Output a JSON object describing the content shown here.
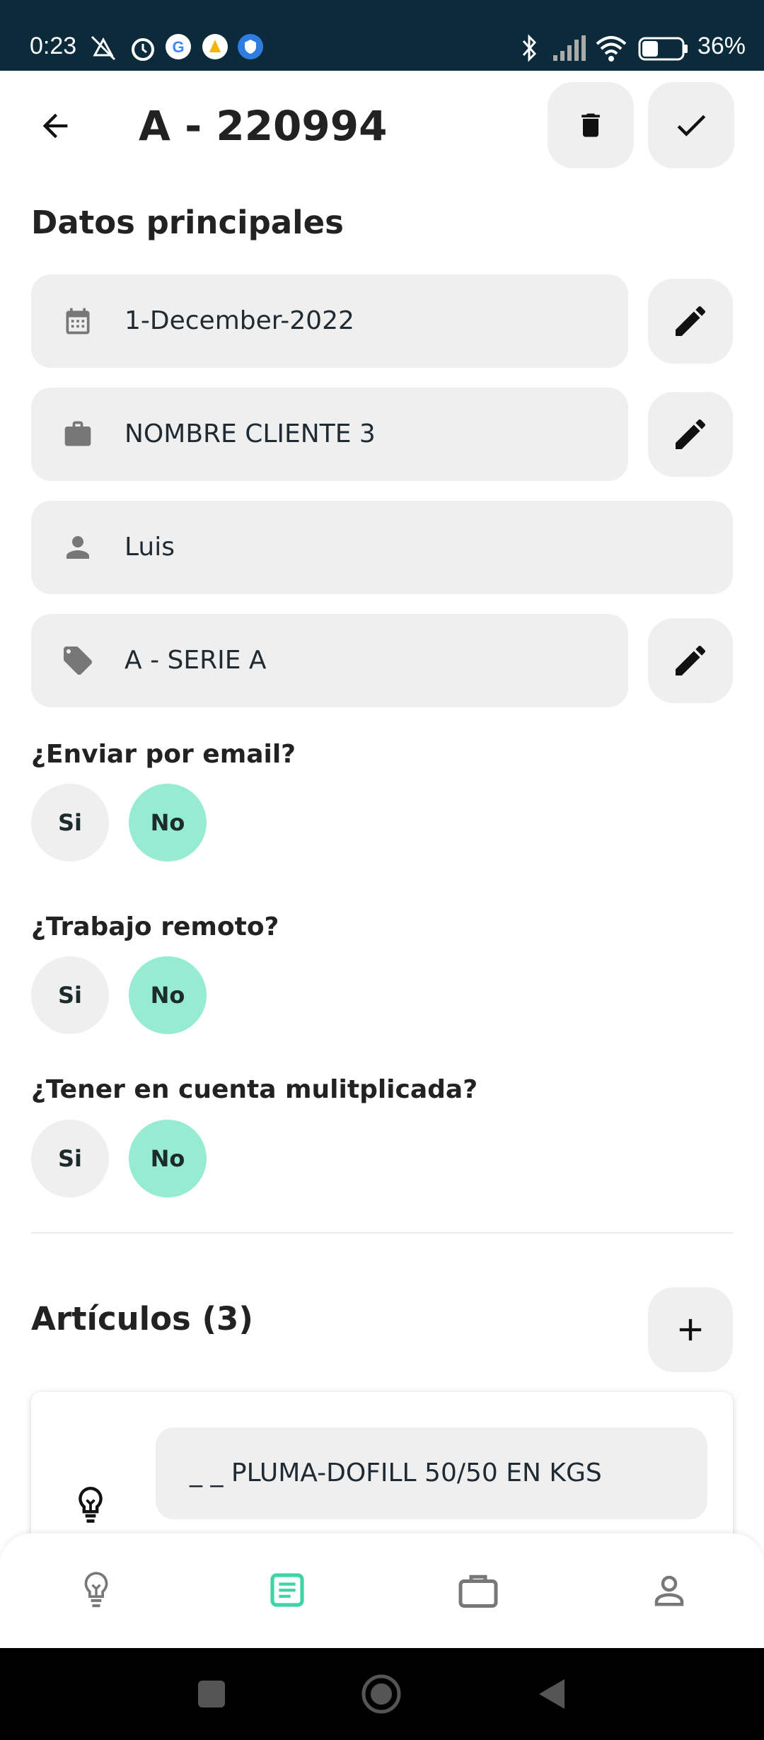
{
  "status_bar": {
    "time": "0:23",
    "battery": "36%"
  },
  "header": {
    "title": "A - 220994",
    "back_icon": "arrow-left-icon",
    "delete_icon": "trash-icon",
    "confirm_icon": "check-icon"
  },
  "main_section": {
    "title": "Datos principales"
  },
  "fields": {
    "date": {
      "value": "1-December-2022",
      "icon": "calendar-icon"
    },
    "client": {
      "value": "NOMBRE CLIENTE 3",
      "icon": "briefcase-icon"
    },
    "user": {
      "value": "Luis",
      "icon": "person-icon"
    },
    "series": {
      "value": "A - SERIE A",
      "icon": "tag-icon"
    }
  },
  "questions": [
    {
      "label": "¿Enviar por email?",
      "yes": "Si",
      "no": "No",
      "selected": "No"
    },
    {
      "label": "¿Trabajo remoto?",
      "yes": "Si",
      "no": "No",
      "selected": "No"
    },
    {
      "label": "¿Tener en cuenta mulitplicada?",
      "yes": "Si",
      "no": "No",
      "selected": "No"
    }
  ],
  "articles": {
    "title": "Artículos (3)",
    "items": [
      {
        "name": "_ _ PLUMA-DOFILL 50/50 EN KGS"
      }
    ]
  },
  "bottom_nav": {
    "items": [
      "lightbulb-icon",
      "document-list-icon",
      "briefcase-icon",
      "person-icon"
    ],
    "active_color": "#3ed5a5"
  },
  "colors": {
    "status_bar": "#0b2a3a",
    "selected_choice": "#96ecd0",
    "field_bg": "#efefef"
  }
}
